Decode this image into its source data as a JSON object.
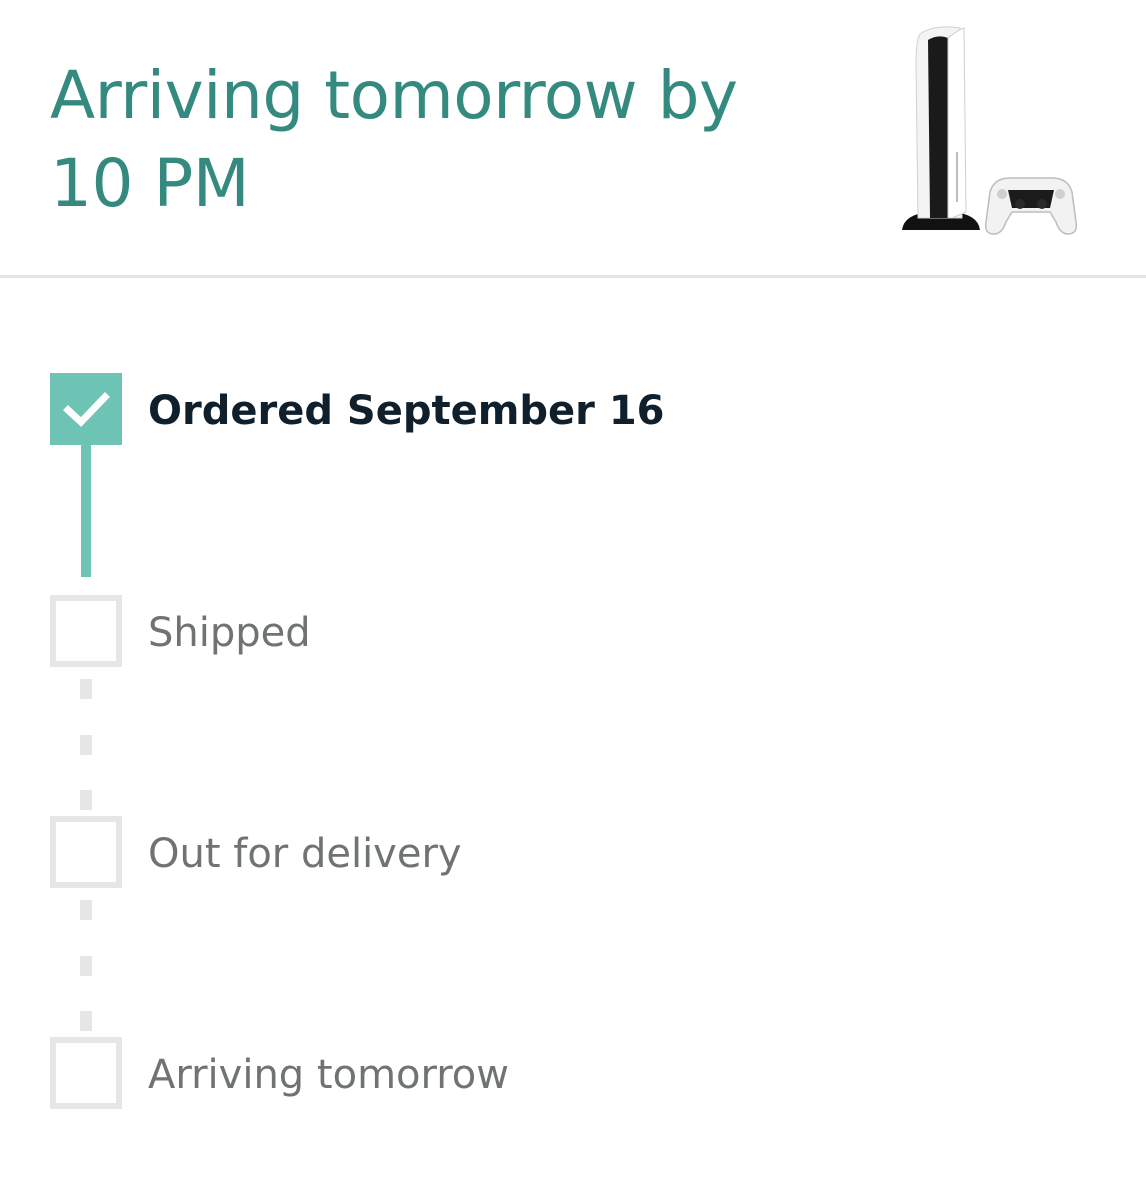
{
  "header": {
    "title": "Arriving tomorrow by 10 PM",
    "product_image": "ps5-console-and-controller"
  },
  "tracker": {
    "steps": [
      {
        "label": "Ordered September 16",
        "status": "complete"
      },
      {
        "label": "Shipped",
        "status": "pending"
      },
      {
        "label": "Out for delivery",
        "status": "pending"
      },
      {
        "label": "Arriving tomorrow",
        "status": "pending"
      }
    ]
  },
  "colors": {
    "accent_teal": "#358a7f",
    "complete_fill": "#6dc3b4",
    "pending_border": "#e6e6e6",
    "completed_text": "#0f1f2c",
    "pending_text": "#6f7373"
  }
}
